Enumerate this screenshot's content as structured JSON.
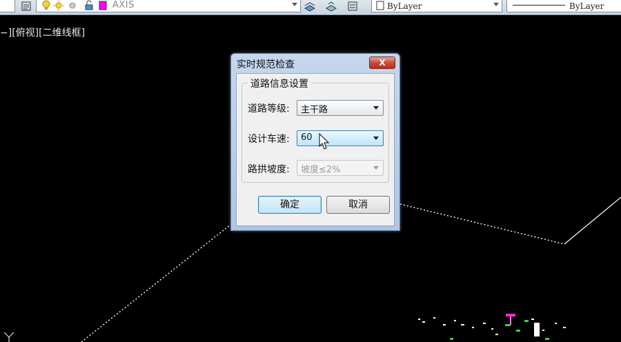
{
  "toolbar": {
    "layer_name": "AXIS",
    "color_value": "ByLayer",
    "linetype_value": "ByLayer",
    "colors": {
      "layer_swatch": "#ff00ff",
      "bulb": "#f2d22e"
    }
  },
  "viewport": {
    "label": "−][俯视][二维线框]",
    "ucs_axis": "Y"
  },
  "dialog": {
    "title": "实时规范检查",
    "close_label": "X",
    "group_title": "道路信息设置",
    "fields": [
      {
        "label": "道路等级:",
        "value": "主干路",
        "state": "normal"
      },
      {
        "label": "设计车速:",
        "value": "60",
        "state": "focused"
      },
      {
        "label": "路拱坡度:",
        "value": "坡度≤2%",
        "state": "disabled"
      }
    ],
    "ok_label": "确定",
    "cancel_label": "取消"
  }
}
